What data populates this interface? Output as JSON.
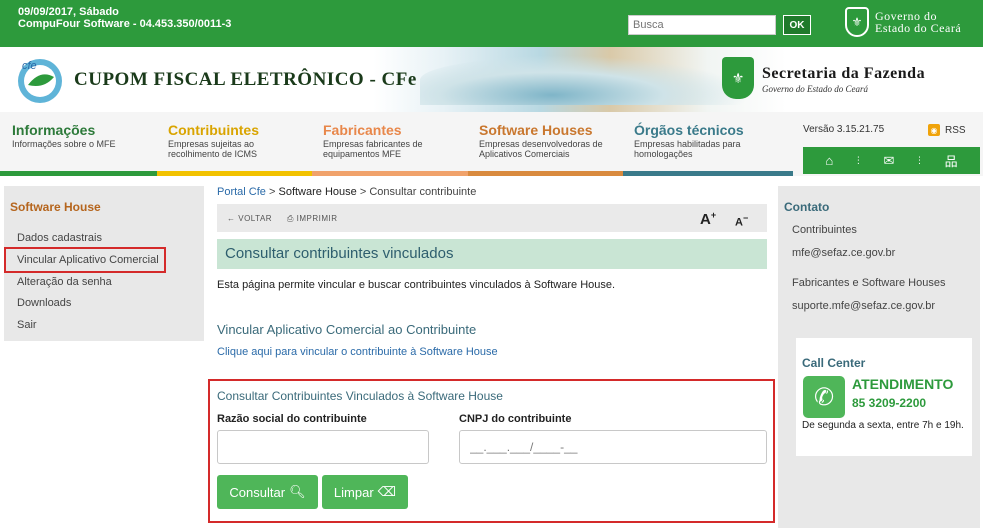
{
  "topbar": {
    "date": "09/09/2017, Sábado",
    "company": "CompuFour Software - 04.453.350/0011-3",
    "search_placeholder": "Busca",
    "search_button": "OK",
    "gov_line1": "Governo do",
    "gov_line2": "Estado do Ceará"
  },
  "banner": {
    "cfe_logo_text": "cfe",
    "title": "CUPOM FISCAL ELETRÔNICO - CFe",
    "sefaz_title": "Secretaria da Fazenda",
    "sefaz_sub": "Governo do Estado do Ceará"
  },
  "nav": {
    "items": [
      {
        "title": "Informações",
        "sub": "Informações sobre o MFE",
        "color": "#2d7a3a",
        "bar": "#2d9a3c"
      },
      {
        "title": "Contribuintes",
        "sub": "Empresas sujeitas ao recolhimento de ICMS",
        "color": "#d9a400",
        "bar": "#f2c200"
      },
      {
        "title": "Fabricantes",
        "sub": "Empresas fabricantes de equipamentos MFE",
        "color": "#e8874a",
        "bar": "#f0a26b"
      },
      {
        "title": "Software Houses",
        "sub": "Empresas desenvolvedoras de Aplicativos Comerciais",
        "color": "#c9772e",
        "bar": "#d98a3e"
      },
      {
        "title": "Órgãos técnicos",
        "sub": "Empresas habilitadas para homologações",
        "color": "#3a7a8a",
        "bar": "#3a7a8a"
      }
    ],
    "version": "Versão 3.15.21.75",
    "rss": "RSS",
    "icons": [
      "home-icon",
      "mail-icon",
      "sitemap-icon"
    ]
  },
  "sidebar": {
    "title": "Software House",
    "items": [
      "Dados cadastrais",
      "Vincular Aplicativo Comercial",
      "Alteração da senha",
      "Downloads",
      "Sair"
    ]
  },
  "breadcrumb": {
    "home": "Portal Cfe",
    "sep1": ">",
    "section": "Software House",
    "sep2": ">",
    "current": "Consultar contribuinte"
  },
  "toolbar": {
    "back": "VOLTAR",
    "print": "IMPRIMIR",
    "font_up": "A+",
    "font_down": "A-"
  },
  "main": {
    "heading": "Consultar contribuintes vinculados",
    "intro": "Esta página permite vincular e buscar contribuintes vinculados à Software House.",
    "link_section_title": "Vincular Aplicativo Comercial ao Contribuinte",
    "link_text": "Clique aqui para vincular o contribuinte à Software House"
  },
  "form": {
    "title": "Consultar Contribuintes Vinculados à Software House",
    "razao_label": "Razão social do contribuinte",
    "razao_value": "",
    "cnpj_label": "CNPJ do contribuinte",
    "cnpj_value": "__.___.___/____-__",
    "consultar_button": "Consultar",
    "limpar_button": "Limpar"
  },
  "contato": {
    "title": "Contato",
    "contribuintes_label": "Contribuintes",
    "contribuintes_email": "mfe@sefaz.ce.gov.br",
    "fabricantes_label": "Fabricantes e Software Houses",
    "fabricantes_email": "suporte.mfe@sefaz.ce.gov.br"
  },
  "callcenter": {
    "title": "Call Center",
    "label": "ATENDIMENTO",
    "phone": "85 3209-2200",
    "hours": "De segunda a sexta, entre 7h e 19h."
  }
}
